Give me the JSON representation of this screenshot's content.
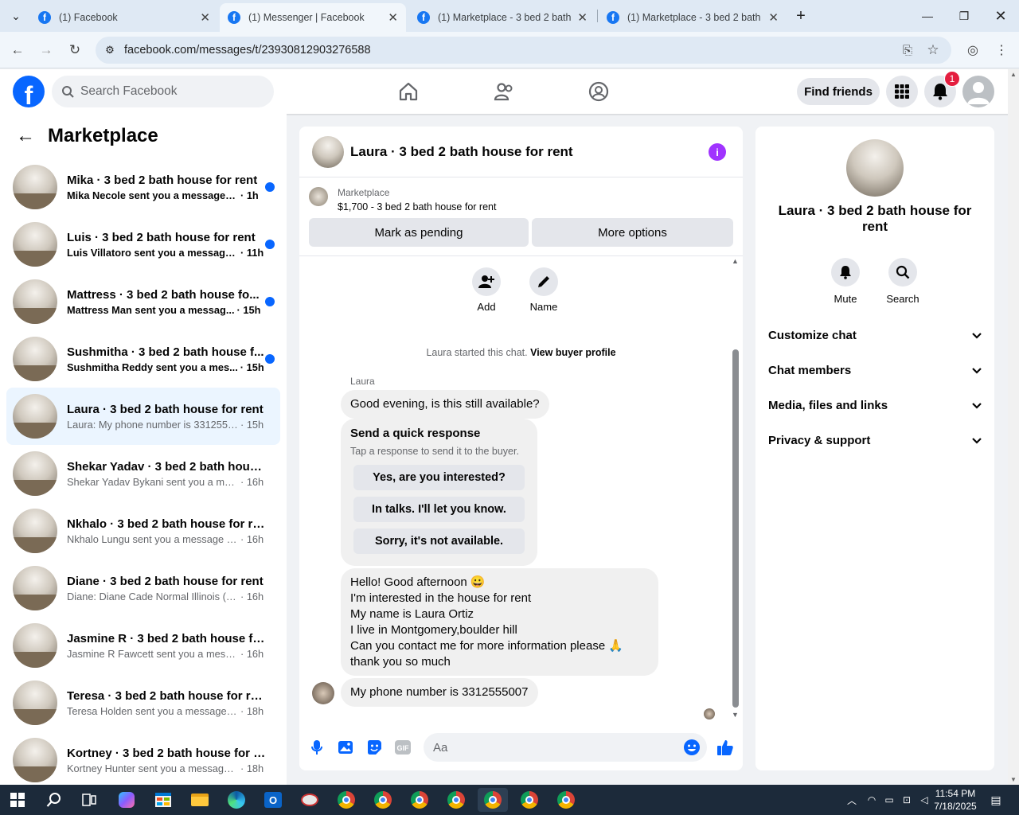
{
  "browser": {
    "tabs": [
      {
        "title": "(1) Facebook",
        "active": false
      },
      {
        "title": "(1) Messenger | Facebook",
        "active": true
      },
      {
        "title": "(1) Marketplace - 3 bed 2 bath h",
        "active": false
      },
      {
        "title": "(1) Marketplace - 3 bed 2 bath h",
        "active": false
      }
    ],
    "url": "facebook.com/messages/t/23930812903276588"
  },
  "header": {
    "search_placeholder": "Search Facebook",
    "find_friends": "Find friends",
    "notification_count": "1"
  },
  "left": {
    "title": "Marketplace",
    "conversations": [
      {
        "name": "Mika · 3 bed 2 bath house for rent",
        "message": "Mika Necole sent you a message a...",
        "time": "· 1h",
        "unread": true
      },
      {
        "name": "Luis · 3 bed 2 bath house for rent",
        "message": "Luis Villatoro sent you a message...",
        "time": "· 11h",
        "unread": true
      },
      {
        "name": "Mattress · 3 bed 2 bath house fo...",
        "message": "Mattress Man sent you a messag...",
        "time": "· 15h",
        "unread": true
      },
      {
        "name": "Sushmitha · 3 bed 2 bath house f...",
        "message": "Sushmitha Reddy sent you a mes...",
        "time": "· 15h",
        "unread": true
      },
      {
        "name": "Laura · 3 bed 2 bath house for rent",
        "message": "Laura: My phone number is 3312555...",
        "time": "· 15h",
        "unread": false
      },
      {
        "name": "Shekar Yadav · 3 bed 2 bath house...",
        "message": "Shekar Yadav Bykani sent you a mess...",
        "time": "· 16h",
        "unread": false
      },
      {
        "name": "Nkhalo · 3 bed 2 bath house for rent",
        "message": "Nkhalo Lungu sent you a message a...",
        "time": "· 16h",
        "unread": false
      },
      {
        "name": "Diane · 3 bed 2 bath house for rent",
        "message": "Diane: Diane Cade Normal Illinois (7...",
        "time": "· 16h",
        "unread": false
      },
      {
        "name": "Jasmine R · 3 bed 2 bath house for...",
        "message": "Jasmine R Fawcett sent you a messa...",
        "time": "· 16h",
        "unread": false
      },
      {
        "name": "Teresa · 3 bed 2 bath house for rent",
        "message": "Teresa Holden sent you a message a...",
        "time": "· 18h",
        "unread": false
      },
      {
        "name": "Kortney · 3 bed 2 bath house for r...",
        "message": "Kortney Hunter sent you a message ...",
        "time": "· 18h",
        "unread": false
      }
    ]
  },
  "chat": {
    "title": "Laura · 3 bed 2 bath house for rent",
    "marketplace_label": "Marketplace",
    "listing": "$1,700 - 3 bed 2 bath house for rent",
    "mark_pending": "Mark as pending",
    "more_options": "More options",
    "add_label": "Add",
    "name_label": "Name",
    "started_text": "Laura started this chat.",
    "view_profile": "View buyer profile",
    "sender": "Laura",
    "msg1": "Good evening, is this still available?",
    "quick_title": "Send a quick response",
    "quick_sub": "Tap a response to send it to the buyer.",
    "quick_replies": [
      "Yes, are you interested?",
      "In talks. I'll let you know.",
      "Sorry, it's not available."
    ],
    "msg2_lines": [
      "Hello! Good afternoon 😀",
      "I'm interested in the house for rent",
      "My name is Laura Ortiz",
      "I live in Montgomery,boulder hill",
      "Can you contact me for more information please 🙏",
      "thank you so much"
    ],
    "msg3": "My phone number is 3312555007",
    "composer_placeholder": "Aa"
  },
  "right": {
    "name": "Laura · 3 bed 2 bath house for rent",
    "mute": "Mute",
    "search": "Search",
    "sections": [
      "Customize chat",
      "Chat members",
      "Media, files and links",
      "Privacy & support"
    ]
  },
  "taskbar": {
    "time": "11:54 PM",
    "date": "7/18/2025"
  },
  "colors": {
    "brand": "#0866ff",
    "unread_dot": "#0866ff",
    "info": "#a033ff",
    "badge": "#e41e3f"
  }
}
